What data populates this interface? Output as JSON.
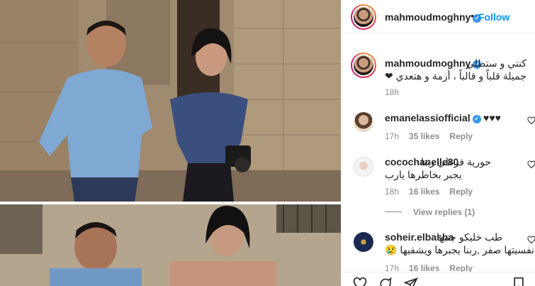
{
  "header": {
    "username": "mahmoudmoghny",
    "dot": "•",
    "follow_label": "Follow"
  },
  "caption": {
    "username": "mahmoudmoghny",
    "line1": "كنتي و ستظلي",
    "line2": "جميلة قلباً و قالباً ، أزمة و هتعدي ❤",
    "time": "18h"
  },
  "comments": [
    {
      "username": "emanelassiofficial",
      "verified": true,
      "text": "♥♥♥",
      "time": "17h",
      "likes": "35 likes",
      "reply": "Reply"
    },
    {
      "username": "cocochanelle80",
      "verified": false,
      "text": "حورية فرغلي ربنا",
      "text2": "يجبر بخاطرها يارب",
      "time": "18h",
      "likes": "16 likes",
      "reply": "Reply"
    },
    {
      "username": "soheir.elbasha",
      "verified": false,
      "text": "طب خليكو جنبها",
      "text2": "نفسيتها صفر ,ربنا يجبرها ويشفيها 😢",
      "time": "17h",
      "likes": "16 likes",
      "reply": "Reply"
    }
  ],
  "view_replies": "View replies (1)",
  "colors": {
    "link": "#0095f6",
    "muted": "#8e8e8e",
    "text": "#262626",
    "verified": "#3897f0"
  },
  "icons": [
    "heart-icon",
    "comment-icon",
    "share-icon",
    "bookmark-icon"
  ]
}
